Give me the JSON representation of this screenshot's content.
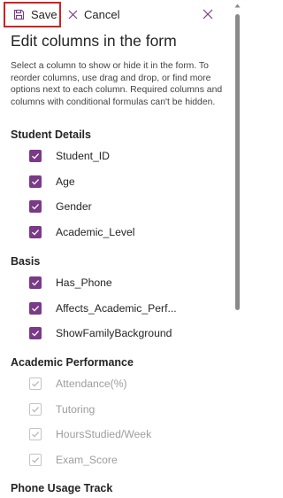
{
  "toolbar": {
    "save_label": "Save",
    "cancel_label": "Cancel"
  },
  "title": "Edit columns in the form",
  "description": "Select a column to show or hide it in the form. To reorder columns, use drag and drop, or find more options next to each column. Required columns and columns with conditional formulas can't be hidden.",
  "colors": {
    "accent": "#7a3a87",
    "save_highlight": "#d42020",
    "disabled_text": "#9d9d9d"
  },
  "sections": [
    {
      "heading": "Student Details",
      "items": [
        {
          "label": "Student_ID",
          "checked": true,
          "disabled": false
        },
        {
          "label": "Age",
          "checked": true,
          "disabled": false
        },
        {
          "label": "Gender",
          "checked": true,
          "disabled": false
        },
        {
          "label": "Academic_Level",
          "checked": true,
          "disabled": false
        }
      ]
    },
    {
      "heading": "Basis",
      "items": [
        {
          "label": "Has_Phone",
          "checked": true,
          "disabled": false
        },
        {
          "label": "Affects_Academic_Perf...",
          "checked": true,
          "disabled": false
        },
        {
          "label": "ShowFamilyBackground",
          "checked": true,
          "disabled": false
        }
      ]
    },
    {
      "heading": "Academic Performance",
      "items": [
        {
          "label": "Attendance(%)",
          "checked": true,
          "disabled": true
        },
        {
          "label": "Tutoring",
          "checked": true,
          "disabled": true
        },
        {
          "label": "HoursStudied/Week",
          "checked": true,
          "disabled": true
        },
        {
          "label": "Exam_Score",
          "checked": true,
          "disabled": true
        }
      ]
    },
    {
      "heading": "Phone Usage Track",
      "items": []
    }
  ]
}
